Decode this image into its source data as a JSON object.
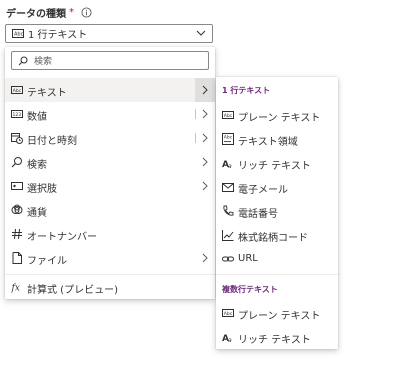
{
  "field": {
    "label": "データの種類",
    "required_mark": "*"
  },
  "dropdown": {
    "value": "1 行テキスト"
  },
  "search": {
    "placeholder": "検索"
  },
  "menu": {
    "items": [
      {
        "label": "テキスト",
        "icon": "text-field-icon"
      },
      {
        "label": "数値",
        "icon": "number-icon"
      },
      {
        "label": "日付と時刻",
        "icon": "calendar-clock-icon"
      },
      {
        "label": "検索",
        "icon": "search-icon"
      },
      {
        "label": "選択肢",
        "icon": "choice-icon"
      },
      {
        "label": "通貨",
        "icon": "currency-icon"
      },
      {
        "label": "オートナンバー",
        "icon": "hash-icon"
      },
      {
        "label": "ファイル",
        "icon": "file-icon"
      },
      {
        "label": "計算式 (プレビュー)",
        "icon": "formula-icon"
      }
    ]
  },
  "submenu": {
    "section1": "1 行テキスト",
    "section1_items": [
      {
        "label": "プレーン テキスト",
        "icon": "plain-text-icon"
      },
      {
        "label": "テキスト領域",
        "icon": "text-area-icon"
      },
      {
        "label": "リッチ テキスト",
        "icon": "rich-text-icon"
      },
      {
        "label": "電子メール",
        "icon": "email-icon"
      },
      {
        "label": "電話番号",
        "icon": "phone-icon"
      },
      {
        "label": "株式銘柄コード",
        "icon": "stock-icon"
      },
      {
        "label": "URL",
        "icon": "link-icon"
      }
    ],
    "section2": "複数行テキスト",
    "section2_items": [
      {
        "label": "プレーン テキスト",
        "icon": "plain-text-icon"
      },
      {
        "label": "リッチ テキスト",
        "icon": "rich-text-icon"
      }
    ]
  },
  "colors": {
    "accent": "#6b2a7a",
    "border": "#8a8886",
    "hover": "#f3f2f1"
  }
}
